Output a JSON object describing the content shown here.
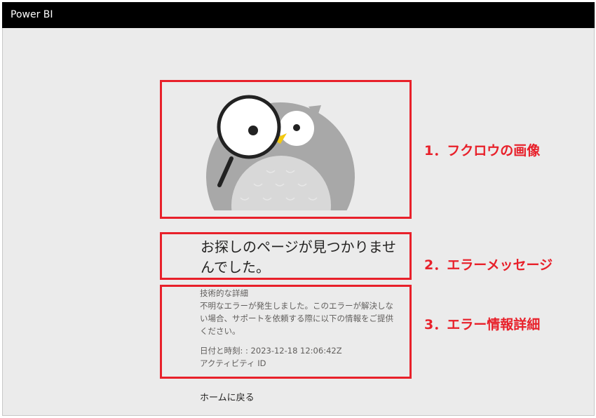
{
  "app": {
    "title": "Power BI"
  },
  "error": {
    "message": "お探しのページが見つかりませんでした。",
    "details_heading": "技術的な詳細",
    "details_text": "不明なエラーが発生しました。このエラーが解決しない場合、サポートを依頼する際に以下の情報をご提供ください。",
    "datetime": "日付と時刻: : 2023-12-18 12:06:42Z",
    "activity_id": "アクティビティ ID",
    "home_link": "ホームに戻る"
  },
  "annotations": [
    {
      "label": "1．フクロウの画像"
    },
    {
      "label": "2．エラーメッセージ"
    },
    {
      "label": "3．エラー情報詳細"
    }
  ],
  "colors": {
    "annotation": "#e8202a",
    "owl_body": "#a8a8a8",
    "owl_belly": "#d8d8d8",
    "beak": "#f2c811"
  }
}
